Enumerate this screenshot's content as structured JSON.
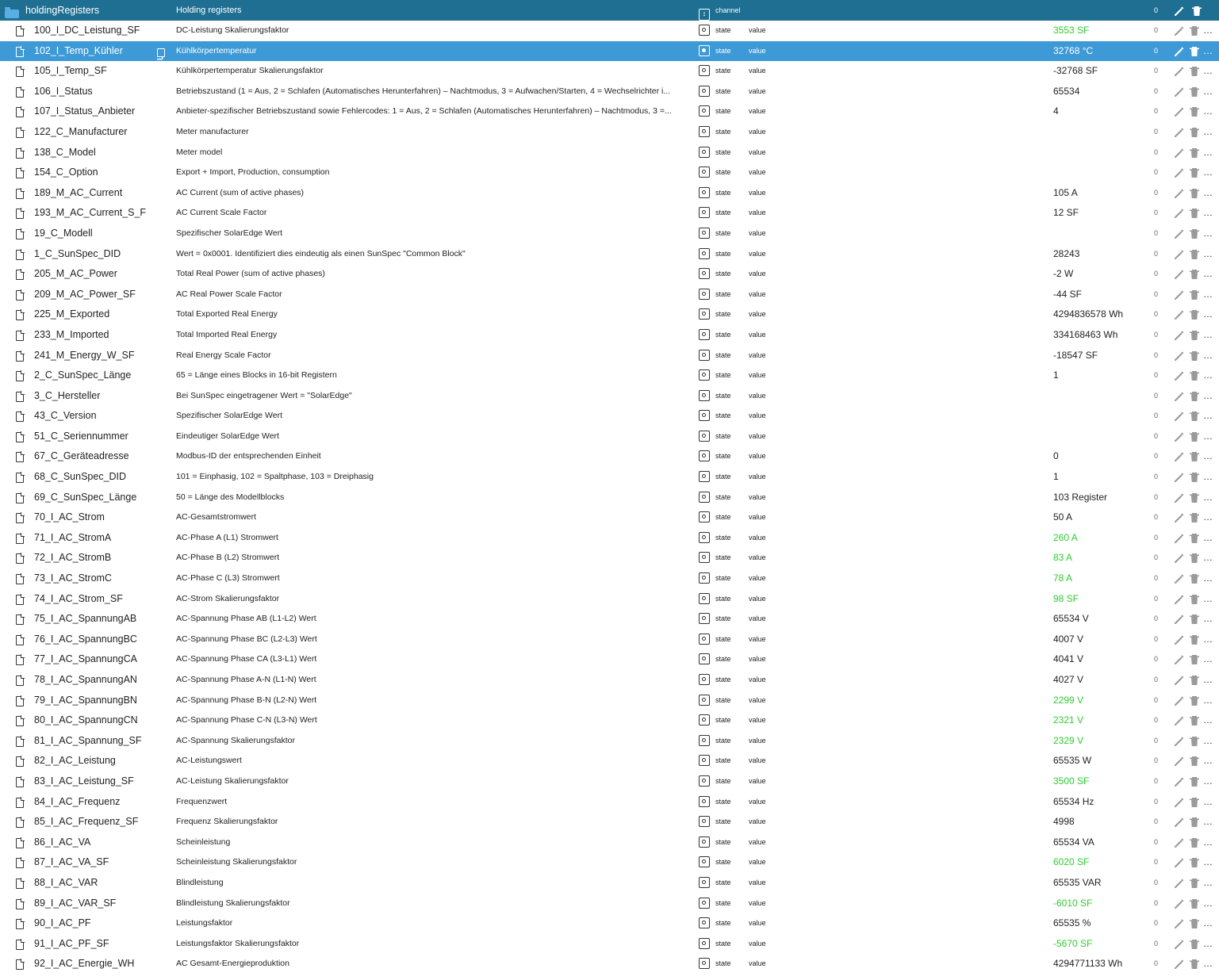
{
  "header": {
    "name": "holdingRegisters",
    "description": "Holding registers",
    "type": "channel",
    "count": "0",
    "icon": "folder-open-icon"
  },
  "colors": {
    "header_bg": "#1f6f93",
    "selected_bg": "#3d9ad6",
    "green_value": "#2ecc2e"
  },
  "selected_row_index": 1,
  "rows": [
    {
      "name": "100_I_DC_Leistung_SF",
      "desc": "DC-Leistung Skalierungsfaktor",
      "type": "state",
      "role": "value",
      "value": "3553 SF",
      "green": true,
      "count": "0"
    },
    {
      "name": "102_I_Temp_Kühler",
      "desc": "Kühlkörpertemperatur",
      "type": "state",
      "role": "value",
      "value": "32768 °C",
      "green": false,
      "count": "0"
    },
    {
      "name": "105_I_Temp_SF",
      "desc": "Kühlkörpertemperatur Skalierungsfaktor",
      "type": "state",
      "role": "value",
      "value": "-32768 SF",
      "green": false,
      "count": "0"
    },
    {
      "name": "106_I_Status",
      "desc": "Betriebszustand (1 = Aus, 2 = Schlafen (Automatisches Herunterfahren) – Nachtmodus, 3 = Aufwachen/Starten, 4 = Wechselrichter i...",
      "type": "state",
      "role": "value",
      "value": "65534",
      "green": false,
      "count": "0"
    },
    {
      "name": "107_I_Status_Anbieter",
      "desc": "Anbieter-spezifischer Betriebszustand sowie Fehlercodes: 1 = Aus, 2 = Schlafen (Automatisches Herunterfahren) – Nachtmodus, 3 =...",
      "type": "state",
      "role": "value",
      "value": "4",
      "green": false,
      "count": "0"
    },
    {
      "name": "122_C_Manufacturer",
      "desc": "Meter manufacturer",
      "type": "state",
      "role": "value",
      "value": "",
      "green": false,
      "count": "0"
    },
    {
      "name": "138_C_Model",
      "desc": "Meter model",
      "type": "state",
      "role": "value",
      "value": "",
      "green": false,
      "count": "0"
    },
    {
      "name": "154_C_Option",
      "desc": "Export + Import, Production, consumption",
      "type": "state",
      "role": "value",
      "value": "",
      "green": false,
      "count": "0"
    },
    {
      "name": "189_M_AC_Current",
      "desc": "AC Current (sum of active phases)",
      "type": "state",
      "role": "value",
      "value": "105 A",
      "green": false,
      "count": "0"
    },
    {
      "name": "193_M_AC_Current_S_F",
      "desc": "AC Current Scale Factor",
      "type": "state",
      "role": "value",
      "value": "12 SF",
      "green": false,
      "count": "0"
    },
    {
      "name": "19_C_Modell",
      "desc": "Spezifischer SolarEdge Wert",
      "type": "state",
      "role": "value",
      "value": "",
      "green": false,
      "count": "0"
    },
    {
      "name": "1_C_SunSpec_DID",
      "desc": "Wert = 0x0001. Identifiziert dies eindeutig als einen SunSpec \"Common Block\"",
      "type": "state",
      "role": "value",
      "value": "28243",
      "green": false,
      "count": "0"
    },
    {
      "name": "205_M_AC_Power",
      "desc": "Total Real Power (sum of active phases)",
      "type": "state",
      "role": "value",
      "value": "-2 W",
      "green": false,
      "count": "0"
    },
    {
      "name": "209_M_AC_Power_SF",
      "desc": "AC Real Power Scale Factor",
      "type": "state",
      "role": "value",
      "value": "-44 SF",
      "green": false,
      "count": "0"
    },
    {
      "name": "225_M_Exported",
      "desc": "Total Exported Real Energy",
      "type": "state",
      "role": "value",
      "value": "4294836578 Wh",
      "green": false,
      "count": "0"
    },
    {
      "name": "233_M_Imported",
      "desc": "Total Imported Real Energy",
      "type": "state",
      "role": "value",
      "value": "334168463 Wh",
      "green": false,
      "count": "0"
    },
    {
      "name": "241_M_Energy_W_SF",
      "desc": "Real Energy Scale Factor",
      "type": "state",
      "role": "value",
      "value": "-18547 SF",
      "green": false,
      "count": "0"
    },
    {
      "name": "2_C_SunSpec_Länge",
      "desc": "65 = Länge eines Blocks in 16-bit Registern",
      "type": "state",
      "role": "value",
      "value": "1",
      "green": false,
      "count": "0"
    },
    {
      "name": "3_C_Hersteller",
      "desc": "Bei SunSpec eingetragener Wert = \"SolarEdge\"",
      "type": "state",
      "role": "value",
      "value": "",
      "green": false,
      "count": "0"
    },
    {
      "name": "43_C_Version",
      "desc": "Spezifischer SolarEdge Wert",
      "type": "state",
      "role": "value",
      "value": "",
      "green": false,
      "count": "0"
    },
    {
      "name": "51_C_Seriennummer",
      "desc": "Eindeutiger SolarEdge Wert",
      "type": "state",
      "role": "value",
      "value": "",
      "green": false,
      "count": "0"
    },
    {
      "name": "67_C_Geräteadresse",
      "desc": "Modbus-ID der entsprechenden Einheit",
      "type": "state",
      "role": "value",
      "value": "0",
      "green": false,
      "count": "0"
    },
    {
      "name": "68_C_SunSpec_DID",
      "desc": "101 = Einphasig, 102 = Spaltphase, 103 = Dreiphasig",
      "type": "state",
      "role": "value",
      "value": "1",
      "green": false,
      "count": "0"
    },
    {
      "name": "69_C_SunSpec_Länge",
      "desc": "50 = Länge des Modellblocks",
      "type": "state",
      "role": "value",
      "value": "103 Register",
      "green": false,
      "count": "0"
    },
    {
      "name": "70_I_AC_Strom",
      "desc": "AC-Gesamtstromwert",
      "type": "state",
      "role": "value",
      "value": "50 A",
      "green": false,
      "count": "0"
    },
    {
      "name": "71_I_AC_StromA",
      "desc": "AC-Phase A (L1) Stromwert",
      "type": "state",
      "role": "value",
      "value": "260 A",
      "green": true,
      "count": "0"
    },
    {
      "name": "72_I_AC_StromB",
      "desc": "AC-Phase B (L2) Stromwert",
      "type": "state",
      "role": "value",
      "value": "83 A",
      "green": true,
      "count": "0"
    },
    {
      "name": "73_I_AC_StromC",
      "desc": "AC-Phase C (L3) Stromwert",
      "type": "state",
      "role": "value",
      "value": "78 A",
      "green": true,
      "count": "0"
    },
    {
      "name": "74_I_AC_Strom_SF",
      "desc": "AC-Strom Skalierungsfaktor",
      "type": "state",
      "role": "value",
      "value": "98 SF",
      "green": true,
      "count": "0"
    },
    {
      "name": "75_I_AC_SpannungAB",
      "desc": "AC-Spannung Phase AB (L1-L2) Wert",
      "type": "state",
      "role": "value",
      "value": "65534 V",
      "green": false,
      "count": "0"
    },
    {
      "name": "76_I_AC_SpannungBC",
      "desc": "AC-Spannung Phase BC (L2-L3) Wert",
      "type": "state",
      "role": "value",
      "value": "4007 V",
      "green": false,
      "count": "0"
    },
    {
      "name": "77_I_AC_SpannungCA",
      "desc": "AC-Spannung Phase CA (L3-L1) Wert",
      "type": "state",
      "role": "value",
      "value": "4041 V",
      "green": false,
      "count": "0"
    },
    {
      "name": "78_I_AC_SpannungAN",
      "desc": "AC-Spannung Phase A-N (L1-N) Wert",
      "type": "state",
      "role": "value",
      "value": "4027 V",
      "green": false,
      "count": "0"
    },
    {
      "name": "79_I_AC_SpannungBN",
      "desc": "AC-Spannung Phase B-N (L2-N) Wert",
      "type": "state",
      "role": "value",
      "value": "2299 V",
      "green": true,
      "count": "0"
    },
    {
      "name": "80_I_AC_SpannungCN",
      "desc": "AC-Spannung Phase C-N (L3-N) Wert",
      "type": "state",
      "role": "value",
      "value": "2321 V",
      "green": true,
      "count": "0"
    },
    {
      "name": "81_I_AC_Spannung_SF",
      "desc": "AC-Spannung Skalierungsfaktor",
      "type": "state",
      "role": "value",
      "value": "2329 V",
      "green": true,
      "count": "0"
    },
    {
      "name": "82_I_AC_Leistung",
      "desc": "AC-Leistungswert",
      "type": "state",
      "role": "value",
      "value": "65535 W",
      "green": false,
      "count": "0"
    },
    {
      "name": "83_I_AC_Leistung_SF",
      "desc": "AC-Leistung Skalierungsfaktor",
      "type": "state",
      "role": "value",
      "value": "3500 SF",
      "green": true,
      "count": "0"
    },
    {
      "name": "84_I_AC_Frequenz",
      "desc": "Frequenzwert",
      "type": "state",
      "role": "value",
      "value": "65534 Hz",
      "green": false,
      "count": "0"
    },
    {
      "name": "85_I_AC_Frequenz_SF",
      "desc": "Frequenz Skalierungsfaktor",
      "type": "state",
      "role": "value",
      "value": "4998",
      "green": false,
      "count": "0"
    },
    {
      "name": "86_I_AC_VA",
      "desc": "Scheinleistung",
      "type": "state",
      "role": "value",
      "value": "65534 VA",
      "green": false,
      "count": "0"
    },
    {
      "name": "87_I_AC_VA_SF",
      "desc": "Scheinleistung Skalierungsfaktor",
      "type": "state",
      "role": "value",
      "value": "6020 SF",
      "green": true,
      "count": "0"
    },
    {
      "name": "88_I_AC_VAR",
      "desc": "Blindleistung",
      "type": "state",
      "role": "value",
      "value": "65535 VAR",
      "green": false,
      "count": "0"
    },
    {
      "name": "89_I_AC_VAR_SF",
      "desc": "Blindleistung Skalierungsfaktor",
      "type": "state",
      "role": "value",
      "value": "-6010 SF",
      "green": true,
      "count": "0"
    },
    {
      "name": "90_I_AC_PF",
      "desc": "Leistungsfaktor",
      "type": "state",
      "role": "value",
      "value": "65535 %",
      "green": false,
      "count": "0"
    },
    {
      "name": "91_I_AC_PF_SF",
      "desc": "Leistungsfaktor Skalierungsfaktor",
      "type": "state",
      "role": "value",
      "value": "-5670 SF",
      "green": true,
      "count": "0"
    },
    {
      "name": "92_I_AC_Energie_WH",
      "desc": "AC Gesamt-Energieproduktion",
      "type": "state",
      "role": "value",
      "value": "4294771133 Wh",
      "green": false,
      "count": "0"
    }
  ],
  "icons": {
    "row": "file-icon",
    "type": "state-icon",
    "copy": "copy-icon",
    "edit": "pencil-icon",
    "delete": "trash-icon",
    "settings": "gear-icon"
  }
}
